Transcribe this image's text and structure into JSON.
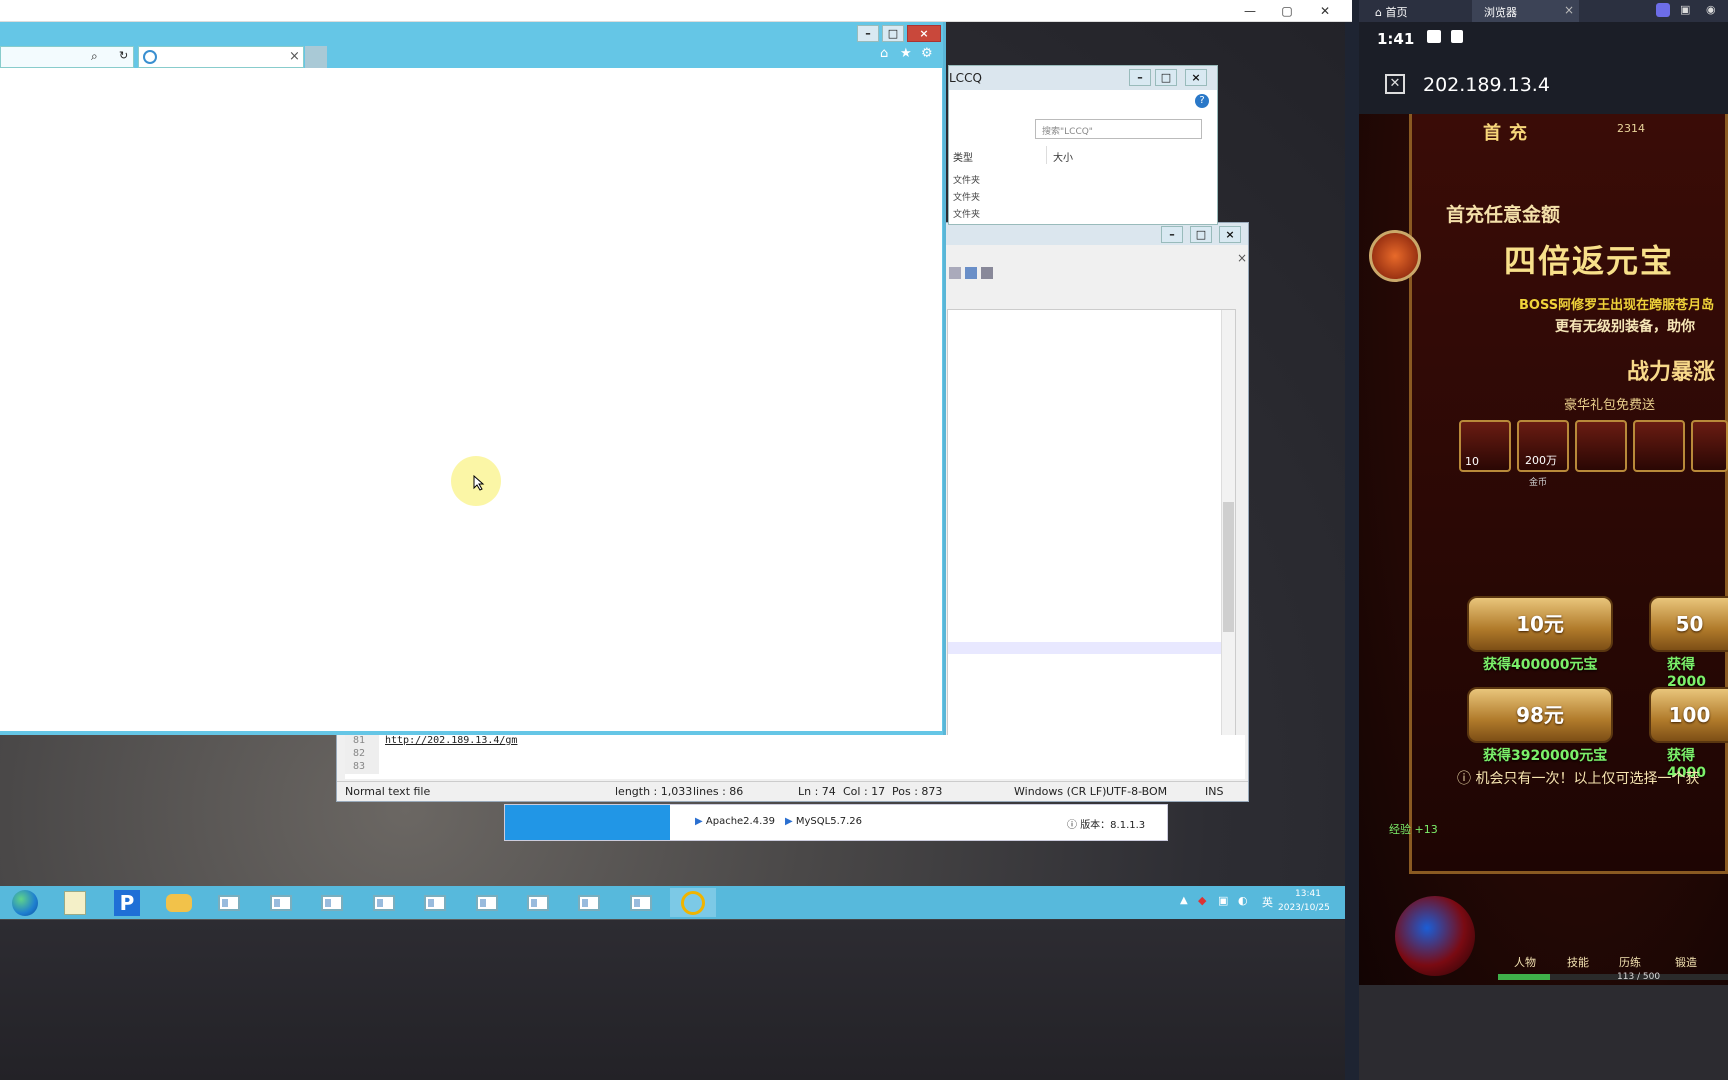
{
  "host": {
    "ctrl_min": "—",
    "ctrl_max": "▢",
    "ctrl_close": "✕"
  },
  "ie": {
    "tab_close": "×",
    "ctrl_min": "–",
    "ctrl_max": "□",
    "ctrl_close": "×"
  },
  "explorer": {
    "title": "LCCQ",
    "search_placeholder": "搜索\"LCCQ\"",
    "columns": [
      "类型",
      "大小"
    ],
    "rows": [
      "文件夹",
      "文件夹",
      "文件夹"
    ]
  },
  "editor": {
    "lines": [
      {
        "num": "81",
        "text": "http://202.189.13.4/gm"
      },
      {
        "num": "82",
        "text": ""
      },
      {
        "num": "83",
        "text": ""
      }
    ],
    "status": {
      "type": "Normal text file",
      "length": "length : 1,033",
      "lines": "lines : 86",
      "ln": "Ln : 74",
      "col": "Col : 17",
      "pos": "Pos : 873",
      "eol": "Windows (CR LF)",
      "encoding": "UTF-8-BOM",
      "mode": "INS"
    }
  },
  "studybar": {
    "apache": "Apache2.4.39",
    "mysql": "MySQL5.7.26",
    "version": "版本：8.1.1.3"
  },
  "taskbar": {
    "time": "13:41",
    "date": "2023/10/25",
    "ime": "英"
  },
  "phone": {
    "tab_home": "首页",
    "tab_browser": "浏览器",
    "tab_close": "×",
    "time": "1:41",
    "url": "202.189.13.4"
  },
  "game": {
    "header": "首充",
    "header_count": "2314",
    "promo_line1": "首充任意金额",
    "promo_big": "四倍返元宝",
    "boss_notice": "BOSS阿修罗王出现在跨服苍月岛",
    "promo_sub": "更有无级别装备，助你",
    "power": "战力暴涨",
    "gift_line": "豪华礼包免费送",
    "items": [
      {
        "badge": "10"
      },
      {
        "badge": "200万"
      },
      {
        "badge": ""
      },
      {
        "badge": ""
      },
      {
        "badge": ""
      }
    ],
    "item_labels": [
      "",
      "金币",
      "",
      "",
      ""
    ],
    "buttons": [
      {
        "price": "10元",
        "reward": "获得400000元宝"
      },
      {
        "price": "50",
        "reward": "获得2000"
      },
      {
        "price": "98元",
        "reward": "获得3920000元宝"
      },
      {
        "price": "100",
        "reward": "获得4000"
      }
    ],
    "notice": "机会只有一次！以上仅可选择一个获",
    "exp": "经验 +13",
    "skills": [
      "人物",
      "技能",
      "历练",
      "锻造"
    ],
    "progress_text": "113 / 500",
    "progress_fraction": 0.226
  }
}
